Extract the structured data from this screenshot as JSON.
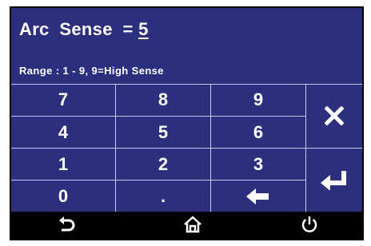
{
  "header": {
    "label": "Arc  Sense  =",
    "value": "5",
    "range": "Range : 1 - 9, 9=High Sense"
  },
  "keypad": {
    "k7": "7",
    "k8": "8",
    "k9": "9",
    "k4": "4",
    "k5": "5",
    "k6": "6",
    "k1": "1",
    "k2": "2",
    "k3": "3",
    "k0": "0",
    "dot": ".",
    "backspace_icon": "left-arrow-icon",
    "clear_icon": "x-icon",
    "enter_icon": "enter-icon"
  },
  "nav": {
    "back_icon": "back-arrow-icon",
    "home_icon": "home-icon",
    "power_icon": "power-icon"
  },
  "colors": {
    "panel": "#2b2f7e",
    "grid_lines": "#c8cbe6",
    "text": "#ffffff",
    "bar": "#000000"
  }
}
